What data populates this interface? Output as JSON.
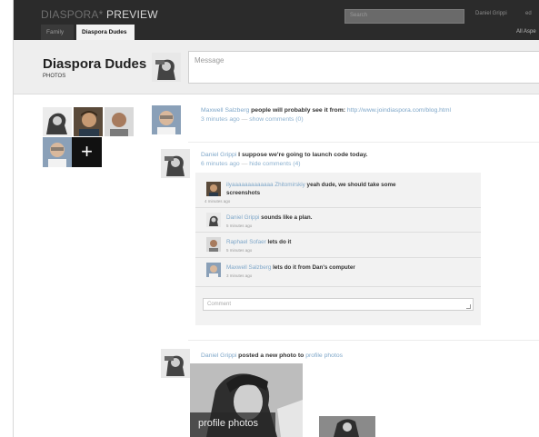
{
  "header": {
    "brand_prefix": "DIASPORA*",
    "brand_suffix": " PREVIEW",
    "search_placeholder": "Search",
    "user_name": "Daniel Grippi",
    "user_extra": "ed",
    "tabs": [
      {
        "label": "Family",
        "active": false
      },
      {
        "label": "Diaspora Dudes",
        "active": true
      }
    ],
    "all_aspects": "All Aspe"
  },
  "aspect": {
    "title": "Diaspora Dudes",
    "subtitle": "PHOTOS"
  },
  "publisher": {
    "placeholder": "Message"
  },
  "members": {
    "add_symbol": "+"
  },
  "posts": [
    {
      "author": "Maxwell Salzberg",
      "text": " people will probably see it from: ",
      "link": "http://www.joindiaspora.com/blog.html",
      "time": "3 minutes ago",
      "action": "show comments (0)"
    },
    {
      "author": "Daniel Grippi",
      "text": " I suppose we're going to launch code today.",
      "time": "6 minutes ago",
      "action": "hide comments (4)",
      "comments": [
        {
          "author": "ilyaaaaaaaaaaaaa Zhitomirskiy",
          "text": " yeah dude, we should take some",
          "text2": "screenshots",
          "time": "4 minutes ago"
        },
        {
          "author": "Daniel Grippi",
          "text": " sounds like a plan.",
          "time": "5 minutes ago"
        },
        {
          "author": "Raphael Sofaer",
          "text": " lets do it",
          "time": "5 minutes ago"
        },
        {
          "author": "Maxwell Salzberg",
          "text": " lets do it from Dan's computer",
          "time": "3 minutes ago"
        }
      ],
      "comment_placeholder": "Comment"
    },
    {
      "author": "Daniel Grippi",
      "text": " posted a new photo to ",
      "album": "profile photos",
      "photo_caption": "profile photos"
    }
  ]
}
